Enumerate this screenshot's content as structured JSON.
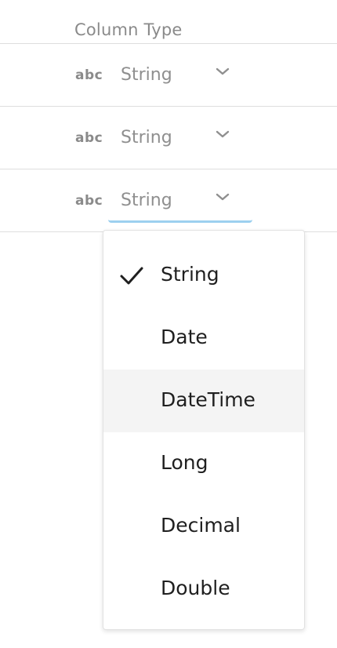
{
  "header": {
    "column_type_label": "Column Type"
  },
  "rows": [
    {
      "type_icon_text": "abc",
      "selected_type": "String"
    },
    {
      "type_icon_text": "abc",
      "selected_type": "String"
    },
    {
      "type_icon_text": "abc",
      "selected_type": "String"
    }
  ],
  "dropdown": {
    "selected": "String",
    "hovered": "DateTime",
    "options": [
      "String",
      "Date",
      "DateTime",
      "Long",
      "Decimal",
      "Double"
    ]
  },
  "icons": {
    "type_icon": "string-type-icon",
    "chevron": "chevron-down-icon",
    "check": "check-icon"
  },
  "colors": {
    "focus_underline": "#9dd0ef",
    "hover_background": "#f4f4f4",
    "muted_text": "#8a8a8a"
  }
}
